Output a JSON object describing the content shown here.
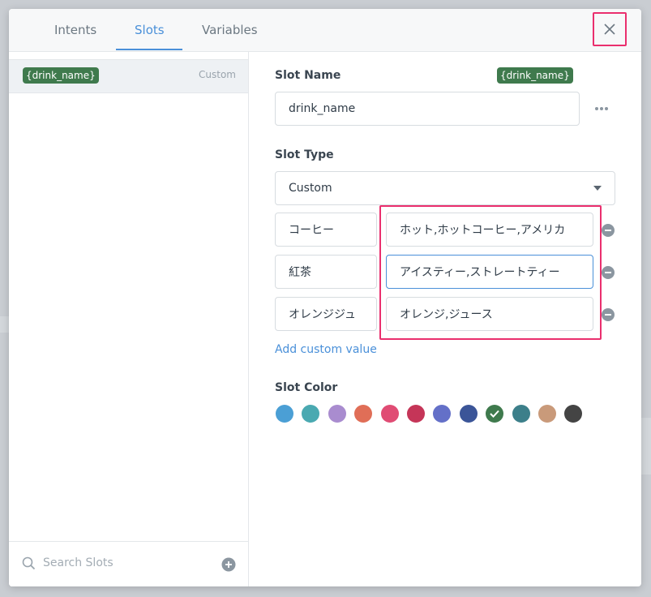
{
  "tabs": [
    {
      "label": "Intents"
    },
    {
      "label": "Slots"
    },
    {
      "label": "Variables"
    }
  ],
  "slots_list": [
    {
      "name": "{drink_name}",
      "type": "Custom"
    }
  ],
  "search": {
    "placeholder": "Search Slots"
  },
  "form": {
    "slot_name_label": "Slot Name",
    "slot_name_badge": "{drink_name}",
    "slot_name_value": "drink_name",
    "slot_type_label": "Slot Type",
    "slot_type_value": "Custom",
    "custom_values": [
      {
        "value": "コーヒー",
        "synonyms": "ホット,ホットコーヒー,アメリカ"
      },
      {
        "value": "紅茶",
        "synonyms": "アイスティー,ストレートティー"
      },
      {
        "value": "オレンジジュ",
        "synonyms": "オレンジ,ジュース"
      }
    ],
    "add_custom_value_label": "Add custom value",
    "slot_color_label": "Slot Color",
    "colors": [
      "#4b9fd5",
      "#4aa9b1",
      "#a98ccf",
      "#e06e57",
      "#e04c74",
      "#c53558",
      "#6470c8",
      "#3b5598",
      "#3f7a4d",
      "#3c7f8a",
      "#c99a7a",
      "#444444"
    ],
    "selected_color": "#3f7a4d"
  },
  "icons": {
    "close": "close-icon",
    "more": "more-horizontal-icon",
    "dropdown": "caret-down-icon",
    "search": "search-icon",
    "add": "plus-circle-icon",
    "remove": "minus-circle-icon",
    "check": "check-icon"
  }
}
